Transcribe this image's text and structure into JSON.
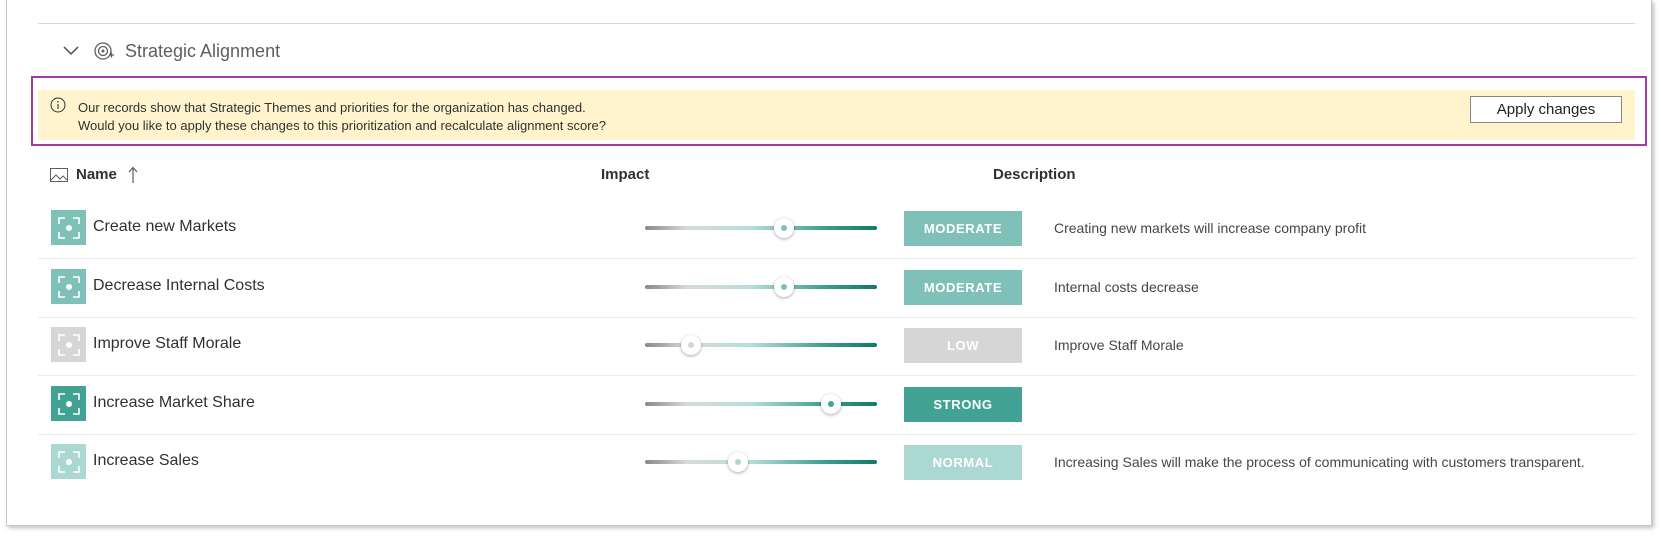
{
  "section": {
    "title": "Strategic Alignment"
  },
  "banner": {
    "line1": "Our records show that Strategic Themes and priorities for the organization has changed.",
    "line2": "Would you like to apply these changes to this prioritization and recalculate alignment score?",
    "button_label": "Apply changes",
    "background": "#fff4ce",
    "highlight_color": "#a13ca4"
  },
  "columns": {
    "name": "Name",
    "impact": "Impact",
    "description": "Description"
  },
  "rows": [
    {
      "name": "Create new Markets",
      "impact": "MODERATE",
      "impact_level": 0.6,
      "description": "Creating new markets will increase company profit",
      "color": "#7fc1b8"
    },
    {
      "name": "Decrease Internal Costs",
      "impact": "MODERATE",
      "impact_level": 0.6,
      "description": "Internal costs decrease",
      "color": "#7fc1b8"
    },
    {
      "name": "Improve Staff Morale",
      "impact": "LOW",
      "impact_level": 0.2,
      "description": "Improve Staff Morale",
      "color": "#d6d6d6"
    },
    {
      "name": "Increase Market Share",
      "impact": "STRONG",
      "impact_level": 0.8,
      "description": "",
      "color": "#42a394"
    },
    {
      "name": "Increase Sales",
      "impact": "NORMAL",
      "impact_level": 0.4,
      "description": "Increasing Sales will make the process of communicating with customers transparent.",
      "color": "#abd8d2"
    }
  ]
}
